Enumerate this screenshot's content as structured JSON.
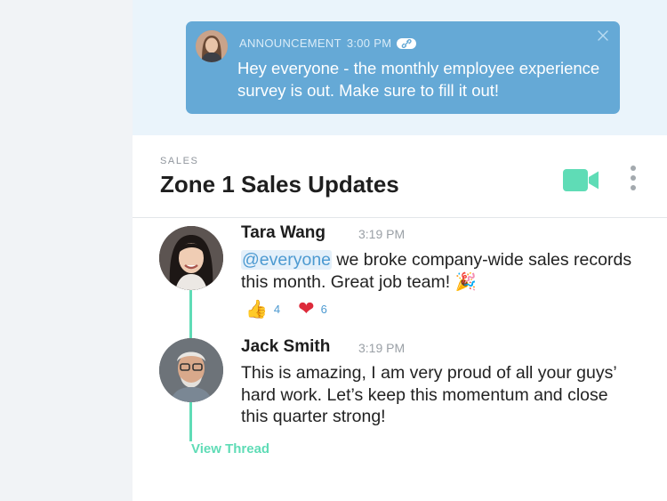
{
  "announcement": {
    "label": "ANNOUNCEMENT",
    "time": "3:00 PM",
    "text": "Hey everyone - the monthly employee experience survey is out. Make sure to fill it out!"
  },
  "channel": {
    "category": "SALES",
    "title": "Zone 1 Sales Updates"
  },
  "messages": [
    {
      "author": "Tara Wang",
      "time": "3:19 PM",
      "mention": "@everyone",
      "text": " we broke company-wide sales records this month. Great job team! ",
      "emoji": "🎉",
      "reactions": [
        {
          "icon": "thumbs-up-icon",
          "glyph": "👍",
          "count": "4"
        },
        {
          "icon": "heart-icon",
          "glyph": "❤",
          "count": "6"
        }
      ]
    },
    {
      "author": "Jack Smith",
      "time": "3:19 PM",
      "text": "This is amazing, I am very proud of all your guys’ hard work. Let’s keep this momentum and close this quarter strong!"
    }
  ],
  "thread": {
    "view_label": "View Thread"
  },
  "colors": {
    "announcement_bg": "#65a9d6",
    "accent_green": "#5fdcb6",
    "mention_blue": "#4d9ad1"
  }
}
